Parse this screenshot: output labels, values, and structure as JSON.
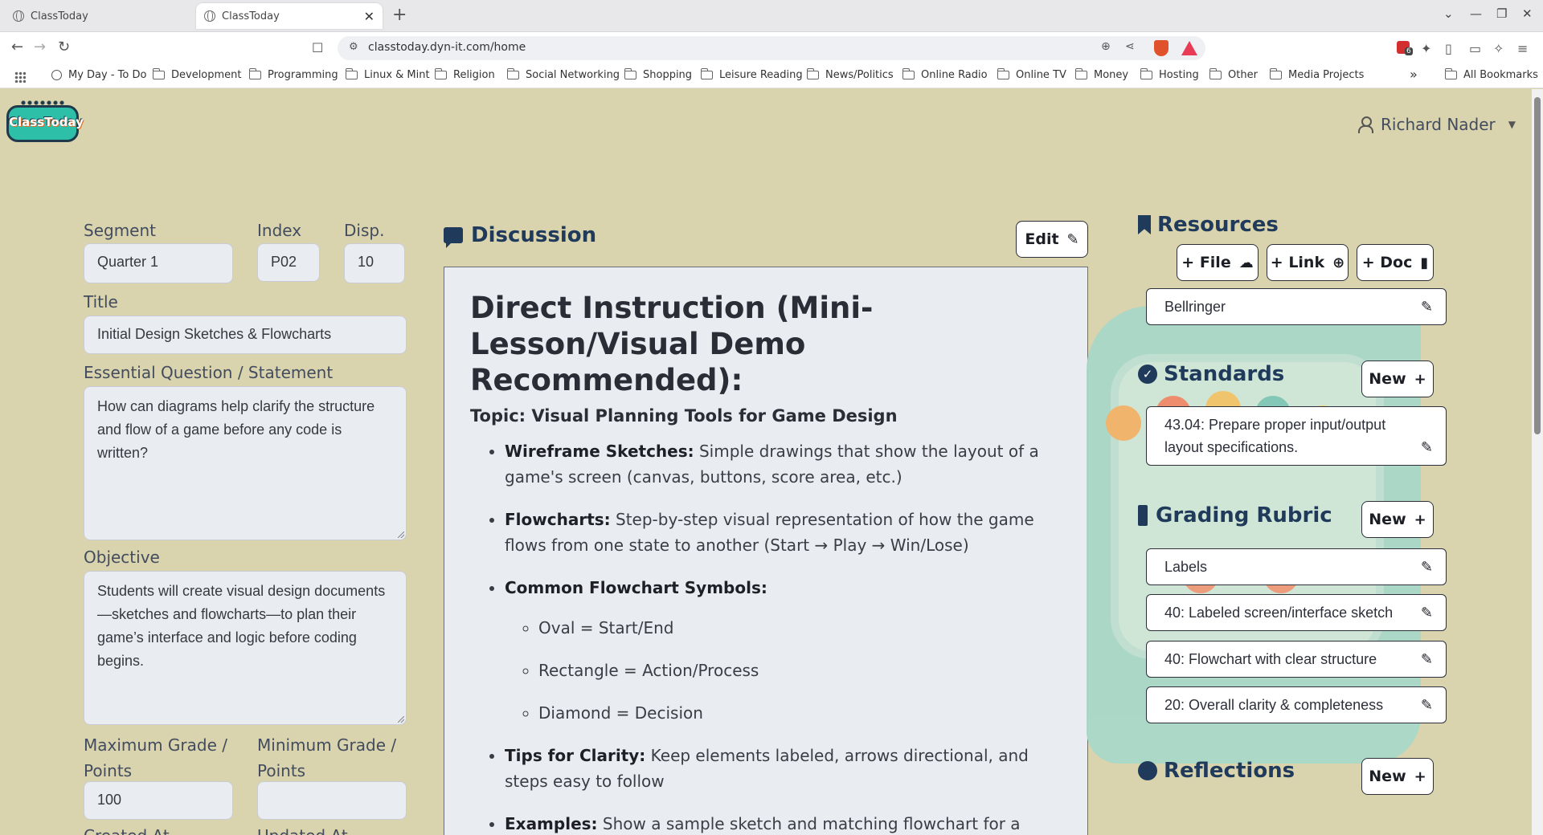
{
  "browser": {
    "tabs": [
      {
        "title": "ClassToday",
        "active": false
      },
      {
        "title": "ClassToday",
        "active": true
      }
    ],
    "url": "classtoday.dyn-it.com/home",
    "shield_count": "",
    "ext_badge": "6",
    "bookmarks": [
      "My Day - To Do",
      "Development",
      "Programming",
      "Linux & Mint",
      "Religion",
      "Social Networking",
      "Shopping",
      "Leisure Reading",
      "News/Politics",
      "Online Radio",
      "Online TV",
      "Money",
      "Hosting",
      "Other",
      "Media Projects"
    ],
    "more_bookmarks": "»",
    "all_bookmarks": "All Bookmarks"
  },
  "app": {
    "logo_text": "ClassToday",
    "user_name": "Richard Nader"
  },
  "form": {
    "segment_label": "Segment",
    "segment_value": "Quarter 1",
    "index_label": "Index",
    "index_value": "P02",
    "disp_label": "Disp.",
    "disp_value": "10",
    "title_label": "Title",
    "title_value": "Initial Design Sketches & Flowcharts",
    "eq_label": "Essential Question / Statement",
    "eq_value": "How can diagrams help clarify the structure and flow of a game before any code is written?",
    "objective_label": "Objective",
    "objective_value": "Students will create visual design documents—sketches and flowcharts—to plan their game’s interface and logic before coding begins.",
    "max_label_1": "Maximum Grade /",
    "max_label_2": "Points",
    "max_value": "100",
    "min_label_1": "Minimum Grade /",
    "min_label_2": "Points",
    "min_value": "",
    "created_label": "Created At",
    "updated_label": "Updated At"
  },
  "discussion": {
    "title": "Discussion",
    "edit_label": "Edit",
    "heading": "Direct Instruction (Mini-Lesson/Visual Demo Recommended):",
    "topic": "Topic: Visual Planning Tools for Game Design",
    "items": [
      {
        "bold": "Wireframe Sketches:",
        "text": " Simple drawings that show the layout of a game's screen (canvas, buttons, score area, etc.)"
      },
      {
        "bold": "Flowcharts:",
        "text": " Step-by-step visual representation of how the game flows from one state to another (Start → Play → Win/Lose)"
      },
      {
        "bold": "Common Flowchart Symbols:",
        "text": ""
      },
      {
        "bold": "Tips for Clarity:",
        "text": " Keep elements labeled, arrows directional, and steps easy to follow"
      },
      {
        "bold": "Examples:",
        "text": " Show a sample sketch and matching flowchart for a game like Pong or Hangman"
      }
    ],
    "symbols": [
      "Oval = Start/End",
      "Rectangle = Action/Process",
      "Diamond = Decision"
    ]
  },
  "resources": {
    "title": "Resources",
    "file_btn": "+ File",
    "link_btn": "+ Link",
    "doc_btn": "+ Doc",
    "items": [
      "Bellringer"
    ]
  },
  "standards": {
    "title": "Standards",
    "new_label": "New",
    "items": [
      "43.04: Prepare proper input/output layout specifications."
    ]
  },
  "rubric": {
    "title": "Grading Rubric",
    "new_label": "New",
    "items": [
      "Labels",
      "40: Labeled screen/interface sketch",
      "40: Flowchart with clear structure",
      "20: Overall clarity & completeness"
    ]
  },
  "reflections": {
    "title": "Reflections",
    "new_label": "New"
  }
}
